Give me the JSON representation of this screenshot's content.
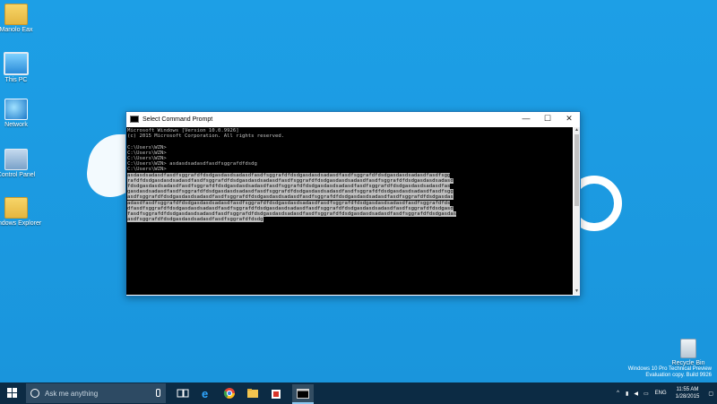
{
  "desktop": {
    "icons": [
      {
        "label": "Manolo Eax"
      },
      {
        "label": "This PC"
      },
      {
        "label": "Network"
      },
      {
        "label": "Control Panel"
      },
      {
        "label": "Windows Explorer"
      },
      {
        "label": "Recycle Bin"
      }
    ],
    "watermark": {
      "line1": "Windows 10 Pro Technical Preview",
      "line2": "Evaluation copy. Build 9926"
    }
  },
  "cmd": {
    "title": "Select Command Prompt",
    "controls": {
      "min": "—",
      "max": "☐",
      "close": "✕"
    },
    "lines": [
      "Microsoft Windows [Version 10.0.9926]",
      "(c) 2015 Microsoft Corporation. All rights reserved.",
      "",
      "C:\\Users\\WZN>",
      "C:\\Users\\WZN>",
      "C:\\Users\\WZN>",
      "C:\\Users\\WZN> asdasdsadasdfasdfsggrafdfdsdg",
      "C:\\Users\\WZN>"
    ],
    "selected_lines": [
      "asdasdsadasdfasdfsggrafdfdsdgasdasdsadasdfasdfsggrafdfdsdgasdasdsadasdfasdfsggrafdfdsdgasdasdsadasdfasdfsgg",
      "rafdfdsdgasdasdsadasdfasdfsggrafdfdsdgasdasdsadasdfasdfsggrafdfdsdgasdasdsadasdfasdfsggrafdfdsdgasdasdsadasd",
      "fdsdgasdasdsadasdfasdfsggrafdfdsdgasdasdsadasdfasdfsggrafdfdsdgasdasdsadasdfasdfsggrafdfdsdgasdasdsadasdfas",
      "gasdasdsadasdfasdfsggrafdfdsdgasdasdsadasdfasdfsggrafdfdsdgasdasdsadasdfasdfsggrafdfdsdgasdasdsadasdfasdfsgg",
      "asdfsggrafdfdsdgasdasdsadasdfasdfsggrafdfdsdgasdasdsadasdfasdfsggrafdfdsdgasdasdsadasdfasdfsggrafdfdsdgasdas",
      "adasdfasdfsggrafdfdsdgasdasdsadasdfasdfsggrafdfdsdgasdasdsadasdfasdfsggrafdfdsdgasdasdsadasdfasdfsggrafdfds",
      "dfasdfsggrafdfdsdgasdasdsadasdfasdfsggrafdfdsdgasdasdsadasdfasdfsggrafdfdsdgasdasdsadasdfasdfsggrafdfdsdgasd",
      "fasdfsggrafdfdsdgasdasdsadasdfasdfsggrafdfdsdgasdasdsadasdfasdfsggrafdfdsdgasdasdsadasdfasdfsggrafdfdsdgasdas",
      "asdfsggrafdfdsdgasdasdsadasdfasdfsggrafdfdsdg"
    ]
  },
  "taskbar": {
    "search_placeholder": "Ask me anything",
    "apps": [
      {
        "icon": "task-view-icon"
      },
      {
        "icon": "internet-explorer-icon"
      },
      {
        "icon": "chrome-icon"
      },
      {
        "icon": "file-explorer-icon"
      },
      {
        "icon": "store-icon"
      },
      {
        "icon": "command-prompt-icon"
      }
    ],
    "tray": {
      "language": "ENG",
      "time": "11:55 AM",
      "date": "1/28/2015"
    }
  },
  "colors": {
    "desktop": "#1b9ae0",
    "taskbar": "#0c2b44",
    "console_bg": "#000000",
    "console_fg": "#c0c0c0"
  }
}
